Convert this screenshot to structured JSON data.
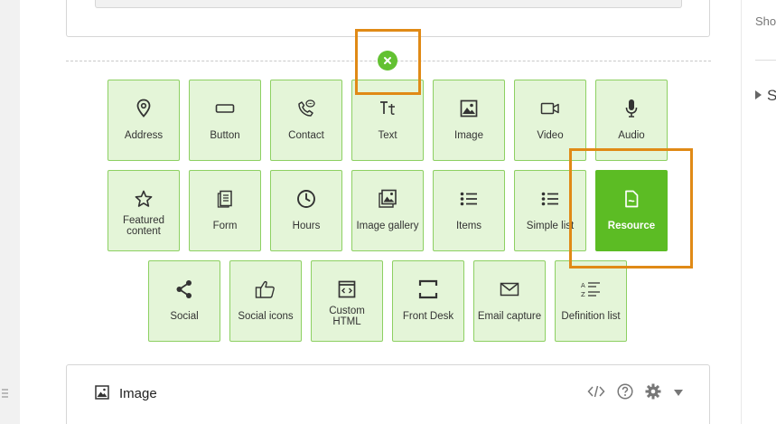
{
  "right_panel": {
    "text": "Sho",
    "section_text": "S"
  },
  "close_button": {
    "icon": "close-icon"
  },
  "tiles": [
    {
      "label": "Address",
      "icon": "map-pin-icon"
    },
    {
      "label": "Button",
      "icon": "button-rect-icon"
    },
    {
      "label": "Contact",
      "icon": "phone-chat-icon"
    },
    {
      "label": "Text",
      "icon": "text-tt-icon"
    },
    {
      "label": "Image",
      "icon": "image-icon"
    },
    {
      "label": "Video",
      "icon": "video-camera-icon"
    },
    {
      "label": "Audio",
      "icon": "microphone-icon"
    },
    {
      "label": "Featured content",
      "icon": "star-icon"
    },
    {
      "label": "Form",
      "icon": "form-document-icon"
    },
    {
      "label": "Hours",
      "icon": "clock-icon"
    },
    {
      "label": "Image gallery",
      "icon": "image-gallery-icon"
    },
    {
      "label": "Items",
      "icon": "bulleted-list-icon"
    },
    {
      "label": "Simple list",
      "icon": "simple-list-icon"
    },
    {
      "label": "Resource",
      "icon": "resource-file-icon",
      "active": true
    },
    {
      "label": "Social",
      "icon": "share-icon"
    },
    {
      "label": "Social icons",
      "icon": "thumbs-up-icon"
    },
    {
      "label": "Custom HTML",
      "icon": "code-window-icon"
    },
    {
      "label": "Front Desk",
      "icon": "front-desk-icon"
    },
    {
      "label": "Email capture",
      "icon": "envelope-icon"
    },
    {
      "label": "Definition list",
      "icon": "definition-list-icon"
    }
  ],
  "bottom_block": {
    "title": "Image",
    "icon": "image-icon",
    "actions": [
      "code-icon",
      "help-icon",
      "gear-icon",
      "caret-down-icon"
    ]
  },
  "colors": {
    "tile_bg": "#e4f5d8",
    "tile_border": "#8dd062",
    "accent_green": "#5cbc24",
    "highlight_orange": "#e08a16"
  }
}
